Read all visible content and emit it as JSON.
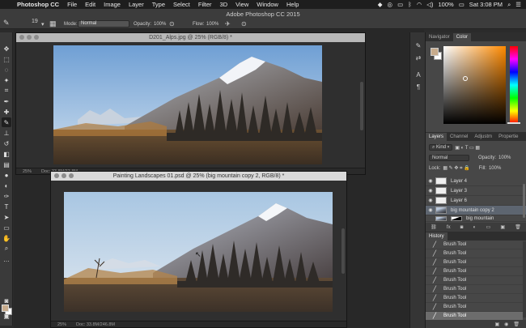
{
  "menubar": {
    "app_name": "Photoshop CC",
    "items": [
      "File",
      "Edit",
      "Image",
      "Layer",
      "Type",
      "Select",
      "Filter",
      "3D",
      "View",
      "Window",
      "Help"
    ],
    "battery": "100%",
    "clock": "Sat 3:08 PM"
  },
  "app_title": "Adobe Photoshop CC 2015",
  "options": {
    "brush_size": "19",
    "mode_label": "Mode:",
    "mode_value": "Normal",
    "opacity_label": "Opacity:",
    "opacity_value": "100%",
    "flow_label": "Flow:",
    "flow_value": "100%"
  },
  "doc1": {
    "title": "D201_Alps.jpg @ 25% (RGB/8) *",
    "zoom": "25%",
    "doc_size": "Doc: 33.8M/33.8M"
  },
  "doc2": {
    "title": "Painting Landscapes 01.psd @ 25% (big mountain copy 2, RGB/8) *",
    "zoom": "25%",
    "doc_size": "Doc: 33.8M/246.8M"
  },
  "color_panel": {
    "tabs": [
      "Navigator",
      "Color"
    ],
    "active_tab": "Color",
    "foreground": "#c7ab8c",
    "background": "#ffffff"
  },
  "layers_panel": {
    "tabs": [
      "Layers",
      "Channel",
      "Adjustm",
      "Propertie"
    ],
    "active_tab": "Layers",
    "kind_label": "Kind",
    "blend_mode": "Normal",
    "opacity_label": "Opacity:",
    "opacity_value": "100%",
    "lock_label": "Lock:",
    "fill_label": "Fill:",
    "fill_value": "100%",
    "layers": [
      {
        "name": "Layer 4"
      },
      {
        "name": "Layer 3"
      },
      {
        "name": "Layer 6"
      },
      {
        "name": "big mountain copy 2"
      },
      {
        "name": "big mountain"
      }
    ],
    "selected_layer": "big mountain copy 2"
  },
  "history_panel": {
    "title": "History",
    "items": [
      "Brush Tool",
      "Brush Tool",
      "Brush Tool",
      "Brush Tool",
      "Brush Tool",
      "Brush Tool",
      "Brush Tool",
      "Brush Tool",
      "Brush Tool"
    ],
    "selected_index": 8
  },
  "icons": {
    "brush": "brush-icon",
    "eye": "eye-icon",
    "history_brush": "brush-icon"
  }
}
